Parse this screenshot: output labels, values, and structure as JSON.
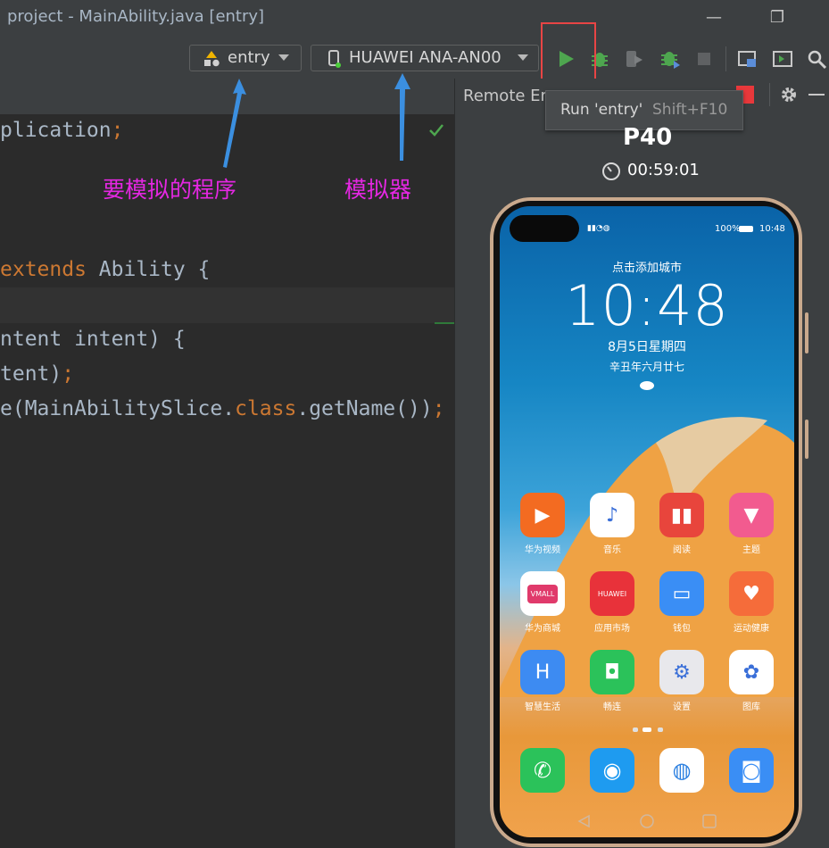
{
  "window": {
    "title": "project - MainAbility.java [entry]",
    "minimize_glyph": "—",
    "restore_glyph": "❐"
  },
  "toolbar": {
    "module_selector": "entry",
    "device_selector": "HUAWEI ANA-AN00",
    "icons": [
      "run-icon",
      "debug-icon",
      "attach-debugger-icon",
      "profile-icon",
      "stop-icon",
      "project-structure-icon",
      "terminal-icon",
      "search-icon"
    ]
  },
  "tooltip": {
    "text": "Run 'entry'",
    "shortcut": "Shift+F10"
  },
  "panel": {
    "title": "Remote Em"
  },
  "annotations": {
    "program_label": "要模拟的程序",
    "emulator_label": "模拟器"
  },
  "code": {
    "line1_a": "plication",
    "line1_b": ";",
    "line2_a": "extends",
    "line2_b": " Ability {",
    "line3": "ntent intent) {",
    "line4_a": "tent)",
    "line4_b": ";",
    "line5_a": "e(MainAbilitySlice.",
    "line5_b": "class",
    "line5_c": ".getName())",
    "line5_d": ";"
  },
  "emulator": {
    "device_name": "P40",
    "timer": "00:59:01",
    "status": {
      "battery": "100%",
      "time": "10:48"
    },
    "lock": {
      "add_city": "点击添加城市",
      "clock": "10:48",
      "date": "8月5日星期四",
      "lunar": "辛丑年六月廿七"
    },
    "apps": [
      {
        "label": "华为视频",
        "color": "#f36b21",
        "icon": "video-icon"
      },
      {
        "label": "音乐",
        "color": "#ffffff",
        "icon": "music-icon"
      },
      {
        "label": "阅读",
        "color": "#e8453c",
        "icon": "book-icon"
      },
      {
        "label": "主题",
        "color": "#f25b8f",
        "icon": "theme-icon"
      },
      {
        "label": "华为商城",
        "color": "#ffffff",
        "icon": "vmall-icon"
      },
      {
        "label": "应用市场",
        "color": "#e8323a",
        "icon": "appgallery-icon"
      },
      {
        "label": "钱包",
        "color": "#3a8ef5",
        "icon": "wallet-icon"
      },
      {
        "label": "运动健康",
        "color": "#f56c3a",
        "icon": "health-icon"
      },
      {
        "label": "智慧生活",
        "color": "#3d8bf2",
        "icon": "smart-life-icon"
      },
      {
        "label": "畅连",
        "color": "#2bc25a",
        "icon": "meetime-icon"
      },
      {
        "label": "设置",
        "color": "#e8e8ec",
        "icon": "settings-icon"
      },
      {
        "label": "图库",
        "color": "#ffffff",
        "icon": "gallery-icon"
      }
    ],
    "vmall_text": "VMALL",
    "huawei_text": "HUAWEI",
    "dock": [
      {
        "icon": "phone-icon",
        "color": "#2bc25a"
      },
      {
        "icon": "messages-icon",
        "color": "#1e9bf0"
      },
      {
        "icon": "browser-icon",
        "color": "#ffffff"
      },
      {
        "icon": "camera-icon",
        "color": "#3a8ef5"
      }
    ]
  }
}
